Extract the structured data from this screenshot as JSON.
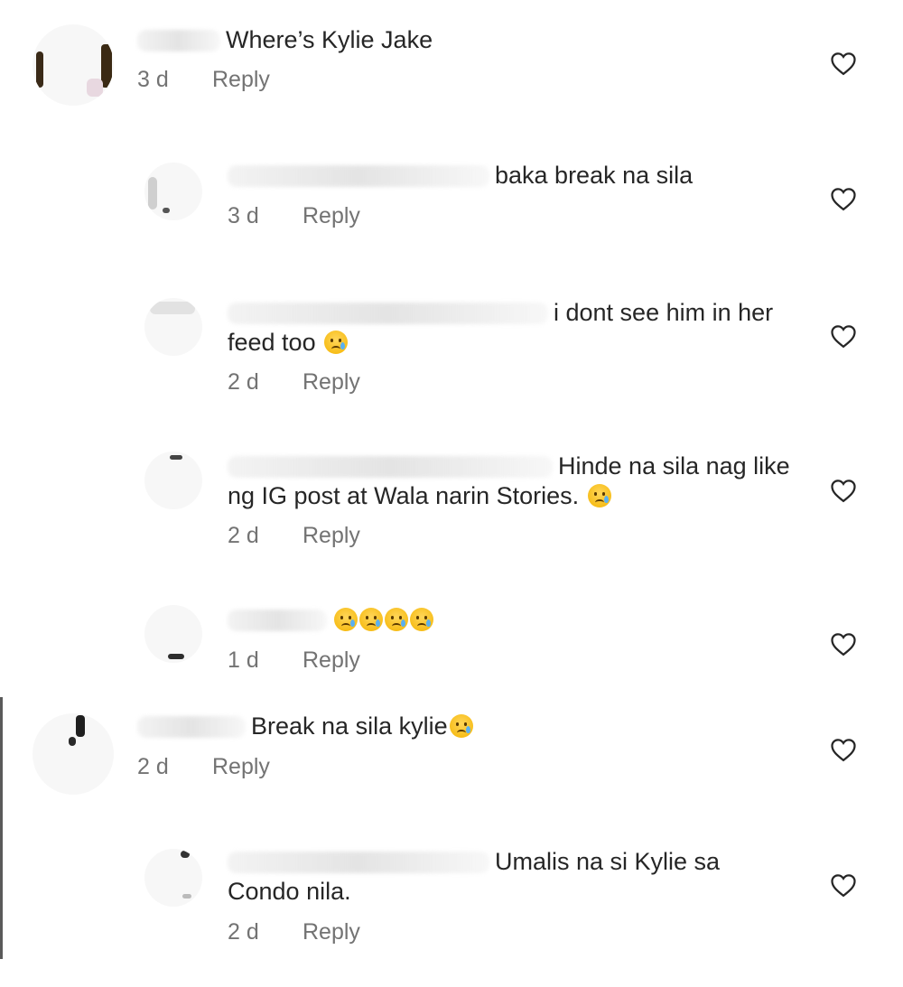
{
  "comments": [
    {
      "text": "Where’s Kylie Jake",
      "time": "3 d",
      "reply": "Reply"
    },
    {
      "text": "baka break na sila",
      "time": "3 d",
      "reply": "Reply"
    },
    {
      "text_line1": "i dont see him in her",
      "text_line2": "feed too",
      "emoji": "crying-face",
      "time": "2 d",
      "reply": "Reply"
    },
    {
      "text_line1": "Hinde na sila nag like",
      "text_line2": "ng IG post at Wala narin Stories.",
      "emoji": "crying-face",
      "time": "2 d",
      "reply": "Reply"
    },
    {
      "emoji": "crying-face",
      "emoji_count": 4,
      "time": "1 d",
      "reply": "Reply"
    },
    {
      "text": "Break na sila kylie",
      "emoji": "crying-face",
      "time": "2 d",
      "reply": "Reply"
    },
    {
      "text_line1": "Umalis na si Kylie sa",
      "text_line2": "Condo nila.",
      "time": "2 d",
      "reply": "Reply"
    }
  ],
  "icons": {
    "like": "heart-outline-icon"
  },
  "colors": {
    "text": "#262626",
    "meta": "#737373",
    "background": "#ffffff"
  }
}
